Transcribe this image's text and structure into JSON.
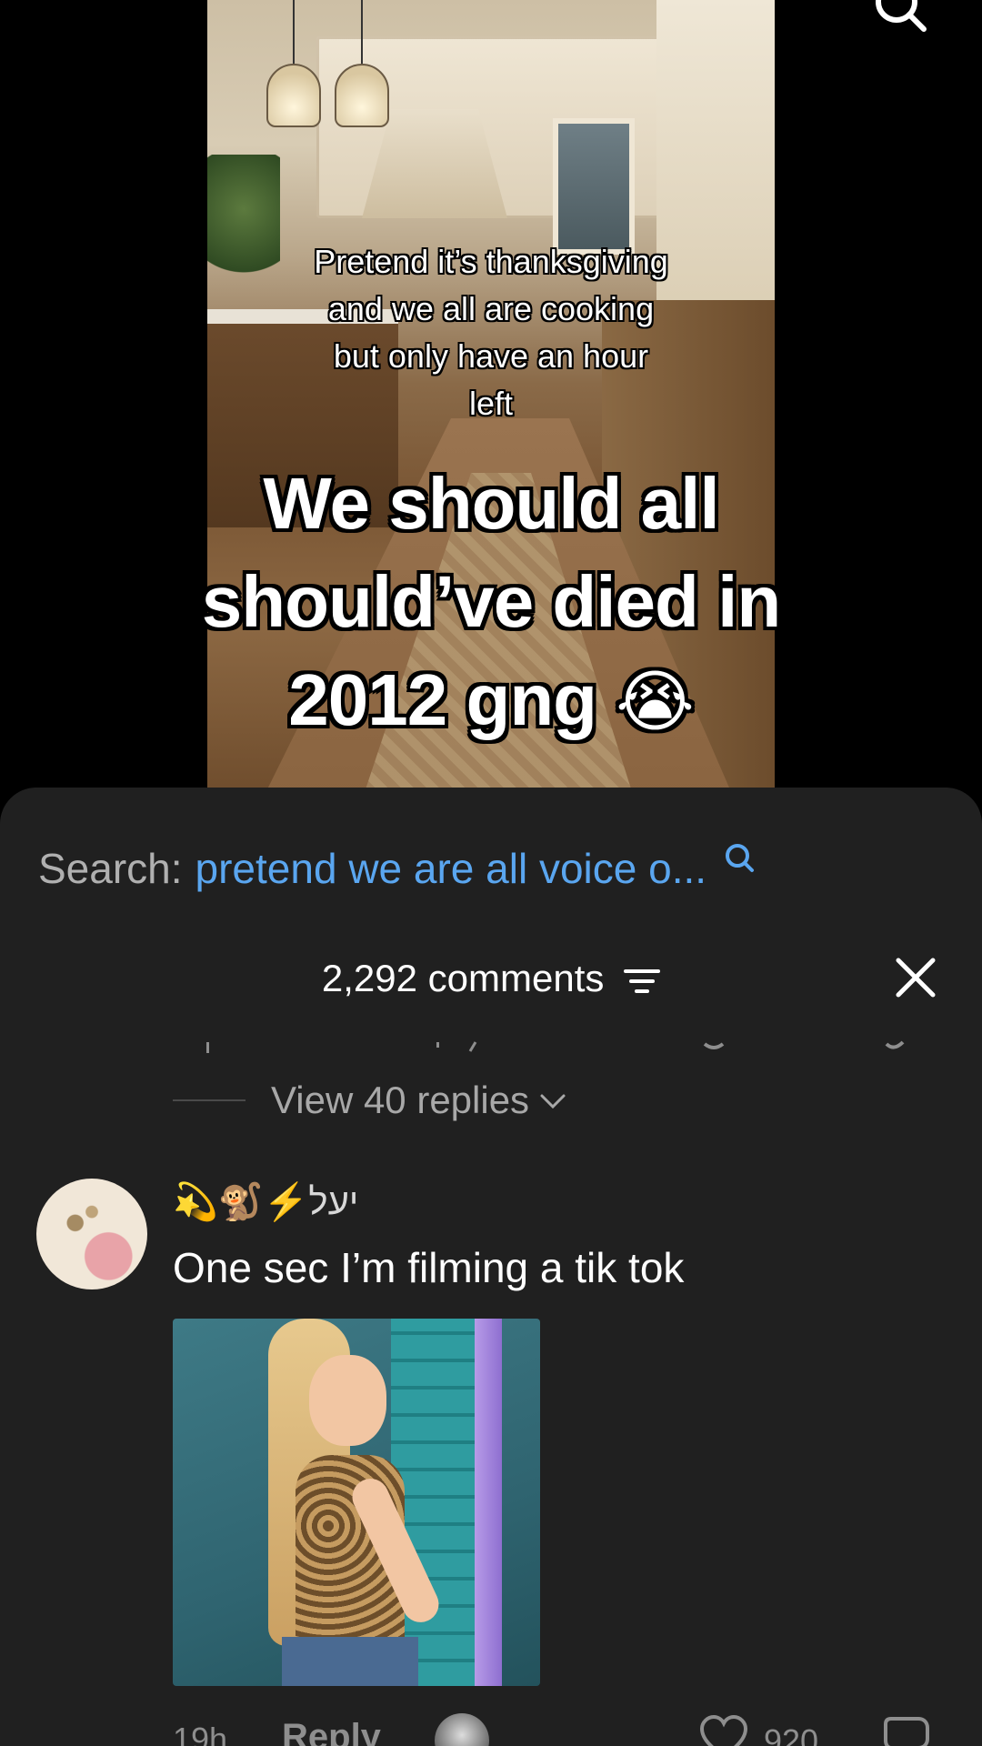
{
  "video": {
    "caption_small": [
      "Pretend it’s thanksgiving",
      "and we all are cooking",
      "but only have an hour",
      "left"
    ],
    "caption_big_lines": [
      "We should all",
      "should’ve died in",
      "2012 gng"
    ],
    "caption_big_emoji": "😭",
    "top_icon": "search-icon"
  },
  "sheet": {
    "search_prefix": "Search:",
    "search_query": "pretend we are all voice o...",
    "search_icon": "search-icon",
    "comment_count": "2,292 comments",
    "filter_icon": "filter-icon",
    "close_icon": "close-icon",
    "view_replies": "View 40 replies",
    "comment": {
      "username": "💫🐒⚡️יעל",
      "text": "One sec I’m filming a tik tok",
      "time": "19h",
      "reply_label": "Reply",
      "like_count": "920"
    }
  },
  "colors": {
    "sheet_bg": "#202020",
    "search_query": "#5aa6f0",
    "muted_text": "#a8a8a8"
  }
}
